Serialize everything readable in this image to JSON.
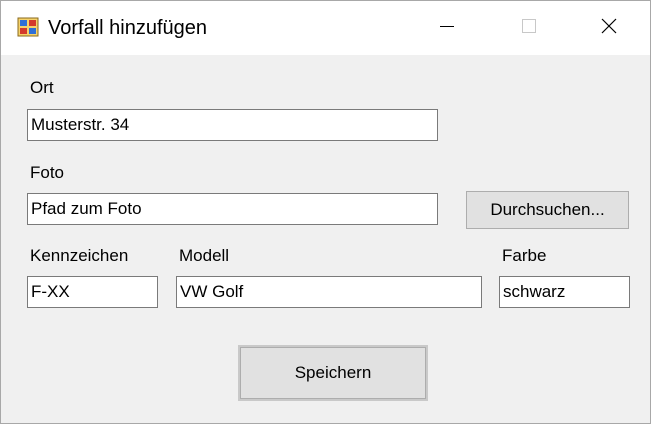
{
  "window": {
    "title": "Vorfall hinzufügen",
    "minimize_icon": "minimize-icon",
    "maximize_icon": "maximize-icon",
    "close_icon": "close-icon",
    "app_icon": "app-icon"
  },
  "form": {
    "ort": {
      "label": "Ort",
      "value": "Musterstr. 34"
    },
    "foto": {
      "label": "Foto",
      "value": "Pfad zum Foto",
      "browse_label": "Durchsuchen..."
    },
    "kennzeichen": {
      "label": "Kennzeichen",
      "value": "F-XX"
    },
    "modell": {
      "label": "Modell",
      "value": "VW Golf"
    },
    "farbe": {
      "label": "Farbe",
      "value": "schwarz"
    },
    "save_label": "Speichern"
  },
  "colors": {
    "window_bg": "#f0f0f0",
    "titlebar_bg": "#ffffff",
    "button_bg": "#e1e1e1"
  }
}
